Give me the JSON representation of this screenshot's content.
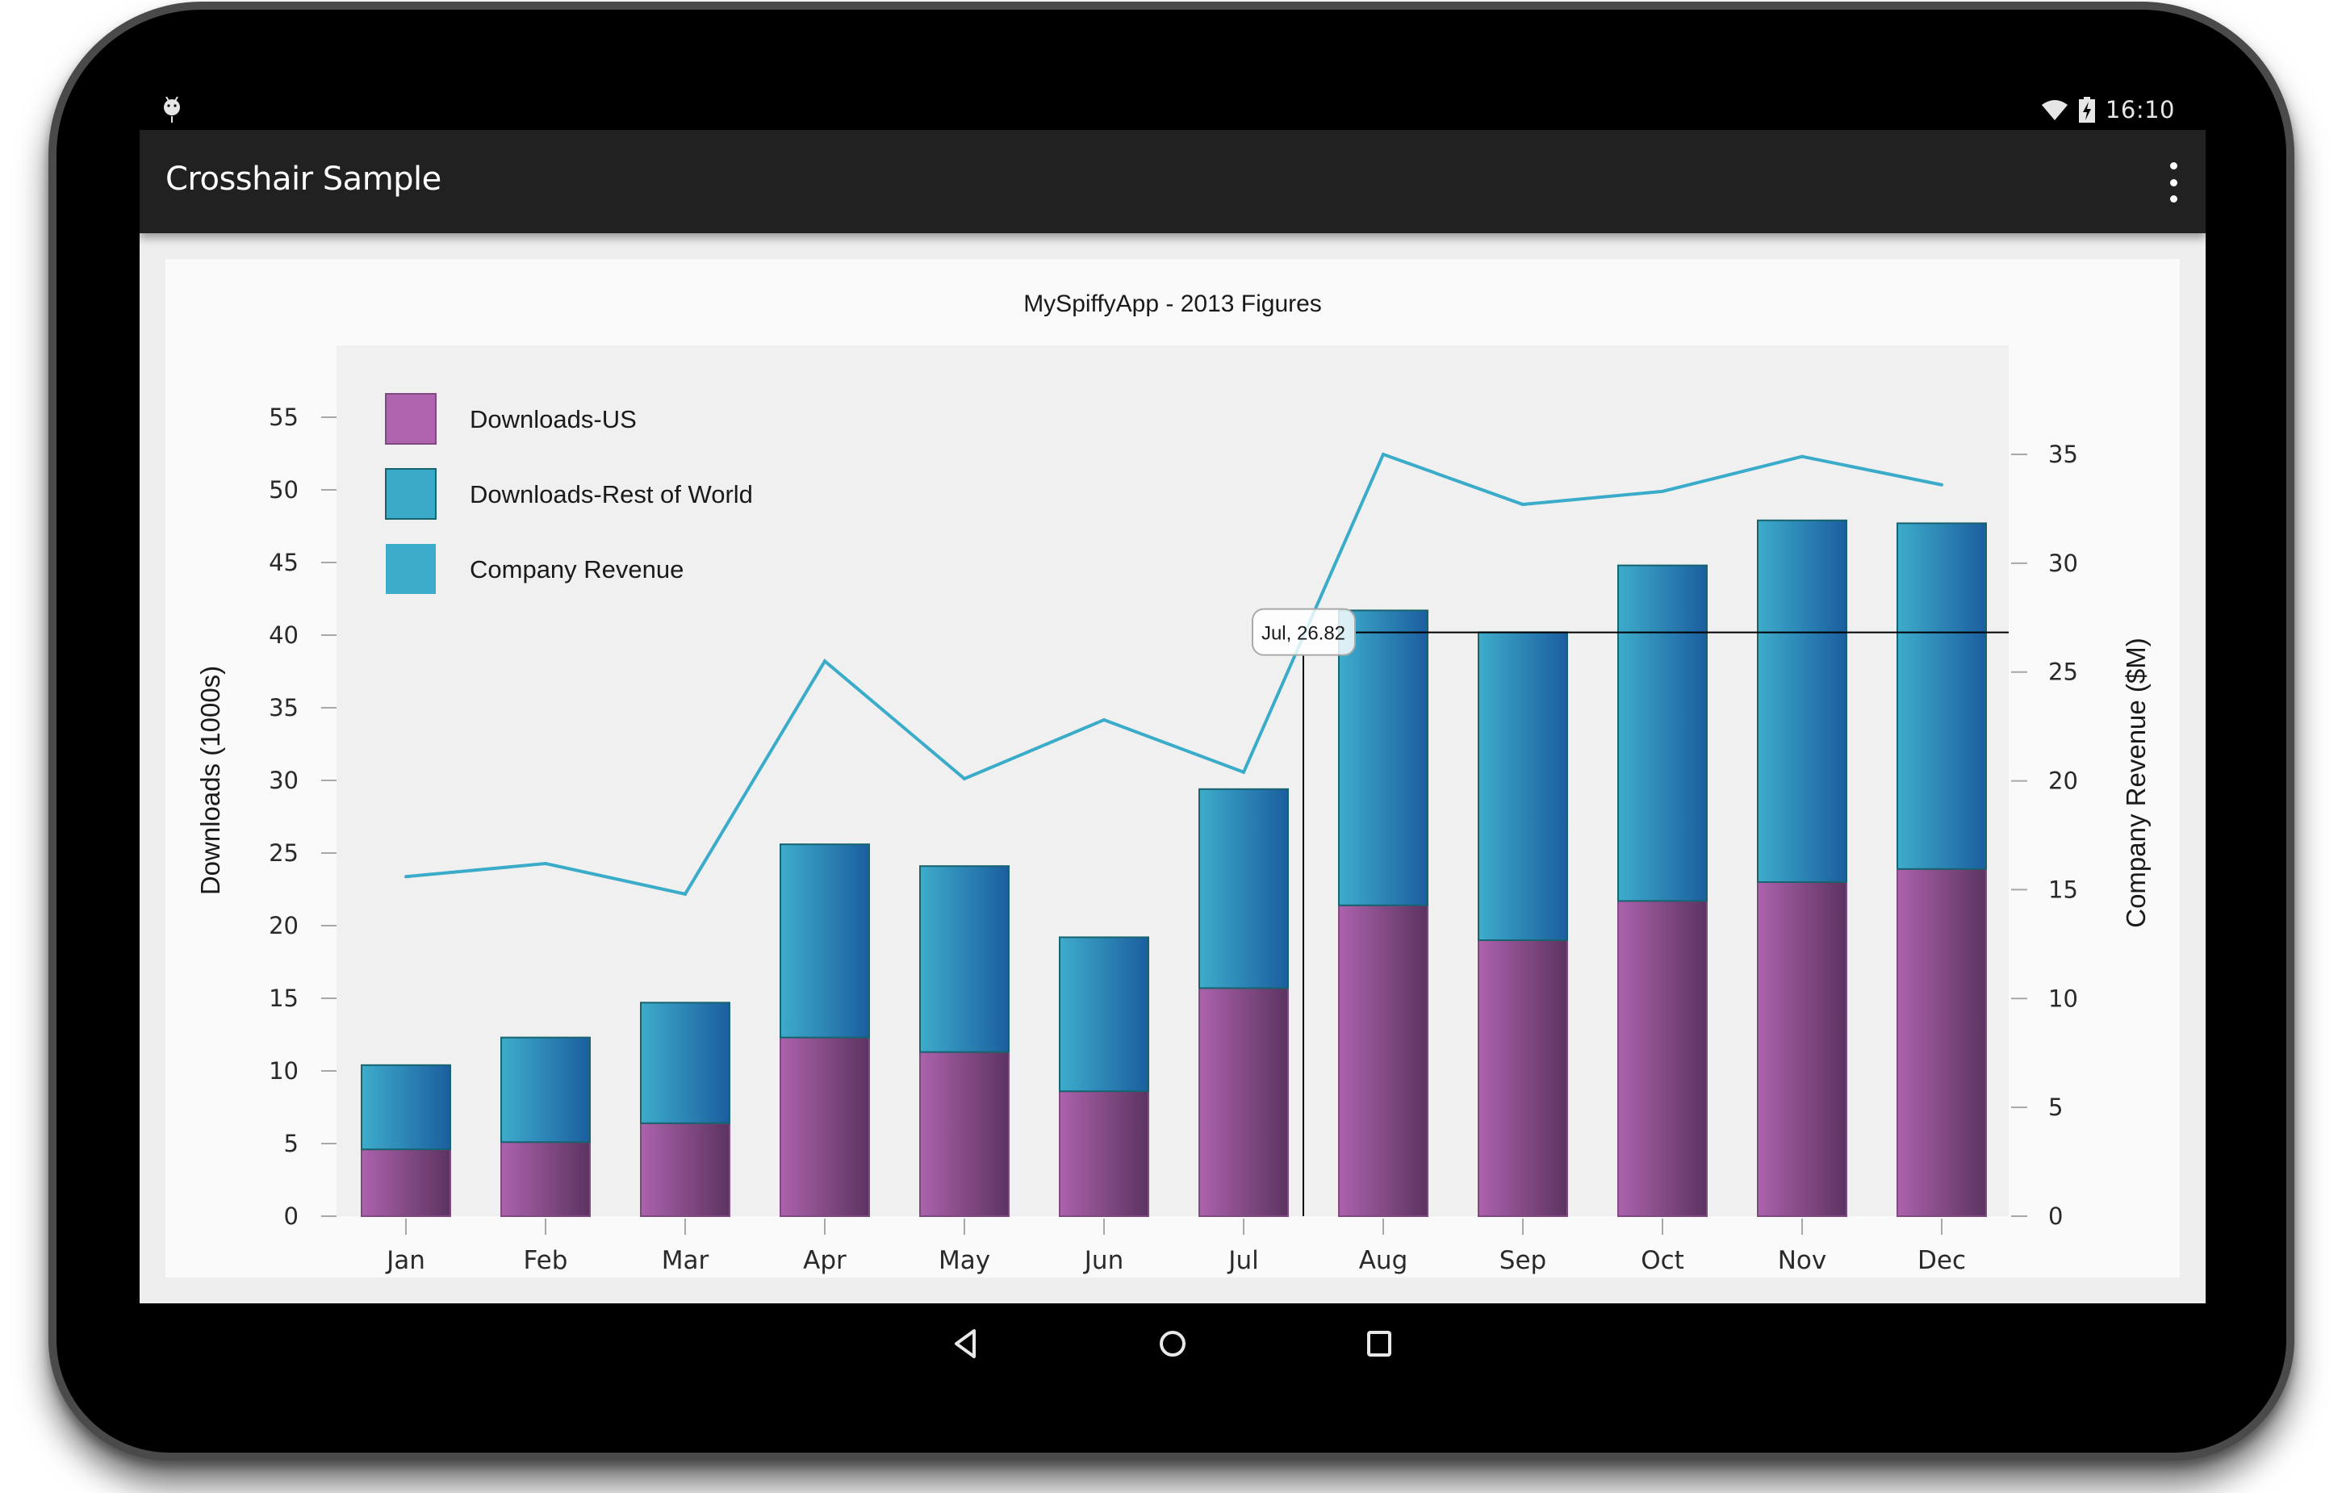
{
  "status_bar": {
    "time": "16:10",
    "icons": [
      "android-debug-icon",
      "wifi-icon",
      "battery-charging-icon"
    ]
  },
  "app_bar": {
    "title": "Crosshair Sample",
    "menu_icon": "overflow-menu-icon"
  },
  "nav_bar": {
    "buttons": [
      "back-icon",
      "home-icon",
      "recents-icon"
    ]
  },
  "colors": {
    "us": "#b064b0",
    "us_dark": "#5e3460",
    "row": "#3aaac8",
    "row_dark": "#1c5fa0",
    "revenue": "#3aacca",
    "plot_bg": "#f0f0f0"
  },
  "crosshair": {
    "category": "Jul",
    "value": 26.82,
    "label": "Jul, 26.82",
    "axis": "secondary"
  },
  "chart_data": {
    "type": "bar",
    "title": "MySpiffyApp - 2013 Figures",
    "stacked": true,
    "categories": [
      "Jan",
      "Feb",
      "Mar",
      "Apr",
      "May",
      "Jun",
      "Jul",
      "Aug",
      "Sep",
      "Oct",
      "Nov",
      "Dec"
    ],
    "series": [
      {
        "name": "Downloads-US",
        "type": "bar",
        "axis": "primary",
        "values": [
          4.6,
          5.1,
          6.4,
          12.3,
          11.3,
          8.6,
          15.7,
          21.4,
          19.0,
          21.7,
          23.0,
          23.9
        ]
      },
      {
        "name": "Downloads-Rest of World",
        "type": "bar",
        "axis": "primary",
        "values": [
          5.8,
          7.2,
          8.3,
          13.3,
          12.8,
          10.6,
          13.7,
          20.3,
          21.2,
          23.1,
          24.9,
          23.8
        ]
      },
      {
        "name": "Company Revenue",
        "type": "line",
        "axis": "secondary",
        "values": [
          15.6,
          16.2,
          14.8,
          25.5,
          20.1,
          22.8,
          20.4,
          35.0,
          32.7,
          33.3,
          34.9,
          33.6
        ]
      }
    ],
    "xlabel": "",
    "ylabel": "Downloads (1000s)",
    "y2label": "Company Revenue ($M)",
    "ylim": [
      0,
      55
    ],
    "yticks": [
      0,
      5,
      10,
      15,
      20,
      25,
      30,
      35,
      40,
      45,
      50,
      55
    ],
    "y2lim": [
      0,
      35
    ],
    "y2ticks": [
      0,
      5,
      10,
      15,
      20,
      25,
      30,
      35
    ],
    "grid": false,
    "legend": {
      "position": "top-left",
      "entries": [
        "Downloads-US",
        "Downloads-Rest of World",
        "Company Revenue"
      ]
    }
  }
}
